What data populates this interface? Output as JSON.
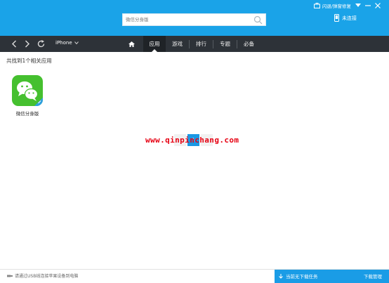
{
  "topbar": {
    "search_placeholder": "微信分身版",
    "feedback": "闪退/弹窗修复",
    "connection": "未连接"
  },
  "nav": {
    "device": "iPhone",
    "tabs": [
      {
        "label": "",
        "icon": "home-icon"
      },
      {
        "label": "应用"
      },
      {
        "label": "游戏"
      },
      {
        "label": "排行"
      },
      {
        "label": "专题"
      },
      {
        "label": "必备"
      }
    ],
    "active_tab": "应用"
  },
  "main": {
    "result_text": "共找到1个相关应用",
    "apps": [
      {
        "name": "微信分身版",
        "icon": "wechat-icon",
        "color": "#45c02f"
      }
    ],
    "pagination": {
      "current": "1"
    }
  },
  "watermark": "www.qinpinchang.com",
  "statusbar": {
    "hint": "请通过USB线连接苹果设备到电脑",
    "download_status": "当前无下载任务",
    "download_manage": "下载管理"
  },
  "colors": {
    "topbar": "#1aa3e8",
    "navbar": "#2d3238",
    "accent": "#1a9ce6",
    "watermark": "#e60012"
  }
}
